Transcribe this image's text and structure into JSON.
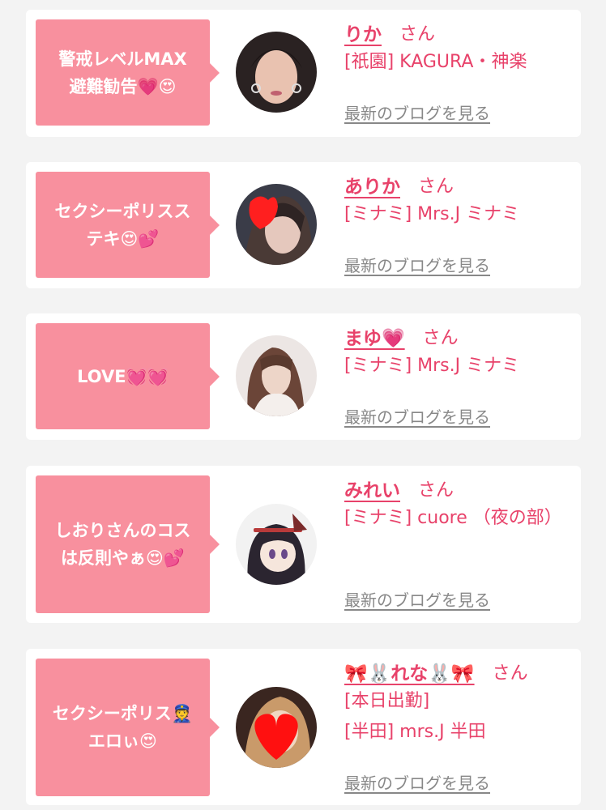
{
  "cards": [
    {
      "comment": "警戒レベルMAX\n避難勧告💗😍",
      "name": "りか",
      "honorific": "さん",
      "shop": "[祇園] KAGURA・神楽",
      "blog_link": "最新のブログを見る"
    },
    {
      "comment": "セクシーポリスス\nテキ😍💕",
      "name": "ありか",
      "honorific": "さん",
      "shop": "[ミナミ] Mrs.J ミナミ",
      "blog_link": "最新のブログを見る"
    },
    {
      "comment": "LOVE💓💓",
      "name": "まゆ💗",
      "honorific": "さん",
      "shop": "[ミナミ] Mrs.J ミナミ",
      "blog_link": "最新のブログを見る"
    },
    {
      "comment": "しおりさんのコス\nは反則やぁ😍💕",
      "name": "みれい",
      "honorific": "さん",
      "shop": "[ミナミ] cuore （夜の部）",
      "blog_link": "最新のブログを見る"
    },
    {
      "comment": "セクシーポリス👮\nエロぃ😍",
      "name": "🎀🐰れな🐰🎀",
      "honorific": "さん",
      "status": "[本日出勤]",
      "shop": "[半田] mrs.J 半田",
      "blog_link": "最新のブログを見る"
    }
  ],
  "colors": {
    "accent": "#e8426a",
    "bubble": "#f8909e",
    "link_gray": "#888888",
    "background": "#f3f3f3"
  }
}
